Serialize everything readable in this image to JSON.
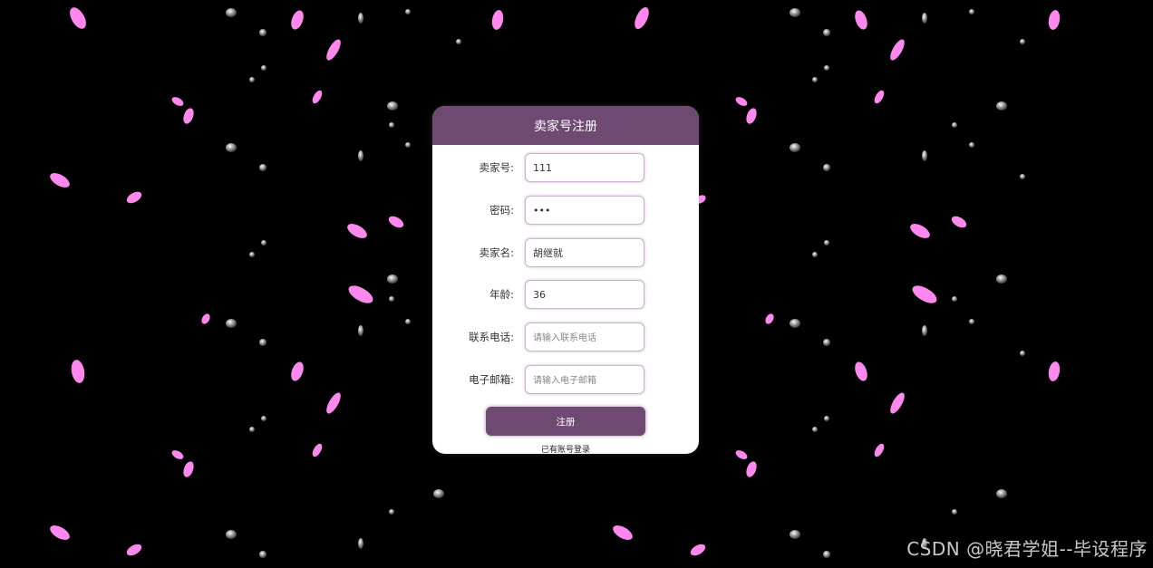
{
  "form": {
    "title": "卖家号注册",
    "fields": [
      {
        "label": "卖家号:",
        "value": "111",
        "placeholder": "",
        "type": "text"
      },
      {
        "label": "密码:",
        "value": "111",
        "placeholder": "",
        "type": "password"
      },
      {
        "label": "卖家名:",
        "value": "胡继就",
        "placeholder": "",
        "type": "text"
      },
      {
        "label": "年龄:",
        "value": "36",
        "placeholder": "",
        "type": "text"
      },
      {
        "label": "联系电话:",
        "value": "",
        "placeholder": "请输入联系电话",
        "type": "text"
      },
      {
        "label": "电子邮箱:",
        "value": "",
        "placeholder": "请输入电子邮箱",
        "type": "text"
      }
    ],
    "submit_label": "注册",
    "login_link": "已有账号登录"
  },
  "watermark": "CSDN @晓君学姐--毕设程序",
  "colors": {
    "background": "#000000",
    "accent": "#6e4a72",
    "petal": "#ff88ee",
    "drop": "#bfbfbf"
  },
  "icons": [
    "petal-icon",
    "water-drop-icon"
  ]
}
